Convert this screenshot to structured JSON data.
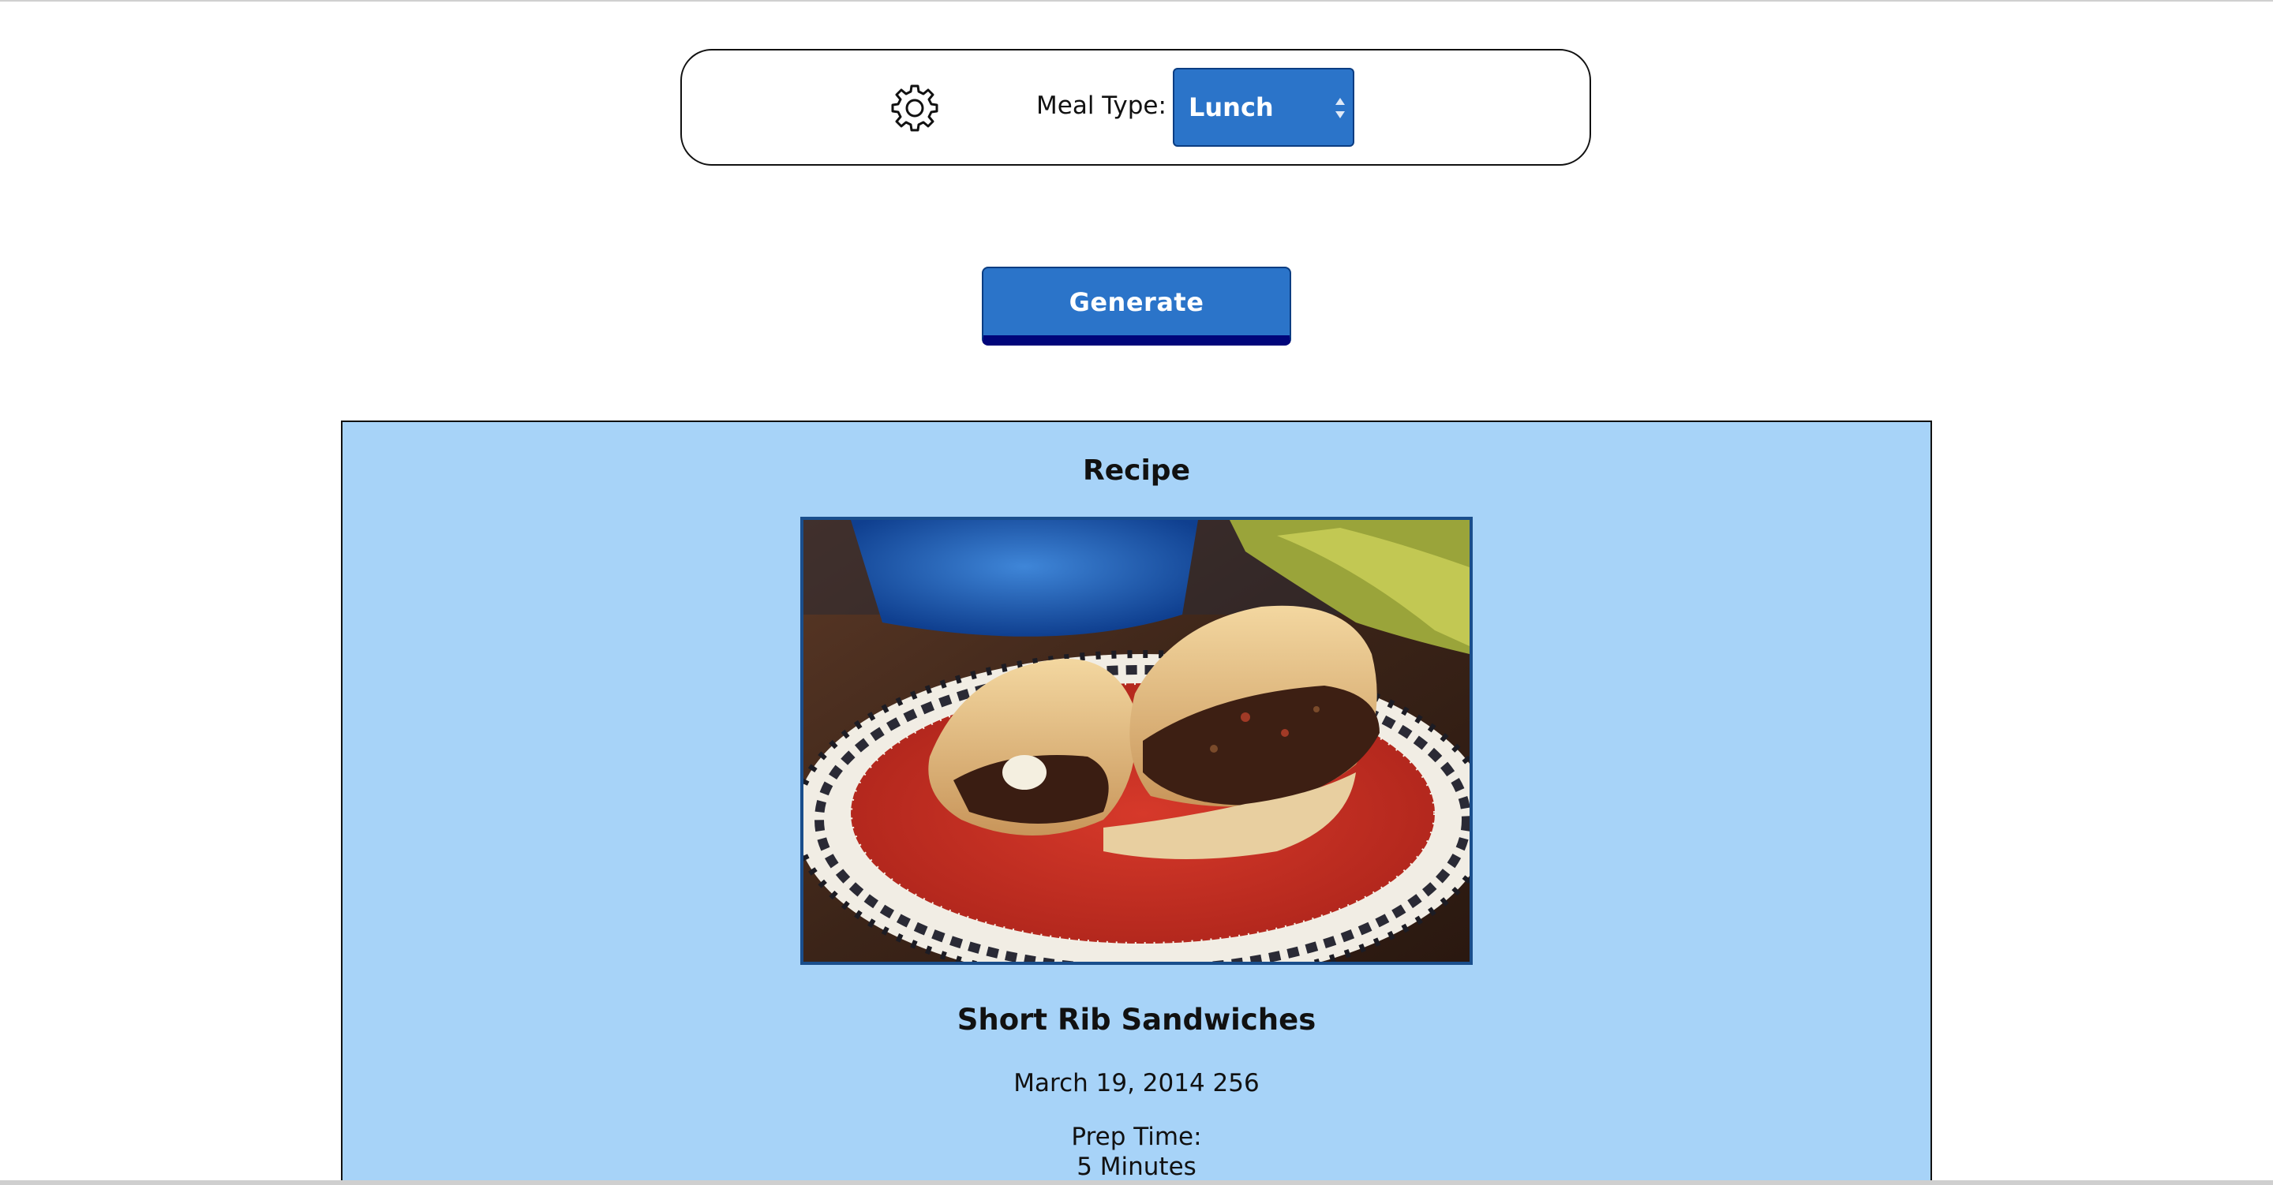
{
  "controls": {
    "settings_icon": "gear-icon",
    "meal_type_label": "Meal Type:",
    "meal_type_selected": "Lunch"
  },
  "generate": {
    "label": "Generate"
  },
  "recipe": {
    "heading": "Recipe",
    "image_icon": "sandwich-photo",
    "title": "Short Rib Sandwiches",
    "meta": "March 19, 2014 256",
    "prep_label": "Prep Time:",
    "prep_value": "5 Minutes"
  },
  "colors": {
    "accent": "#2b74c9",
    "accent_border": "#0b3d82",
    "button_shadow": "#00057a",
    "card_background": "#a7d3f8"
  }
}
